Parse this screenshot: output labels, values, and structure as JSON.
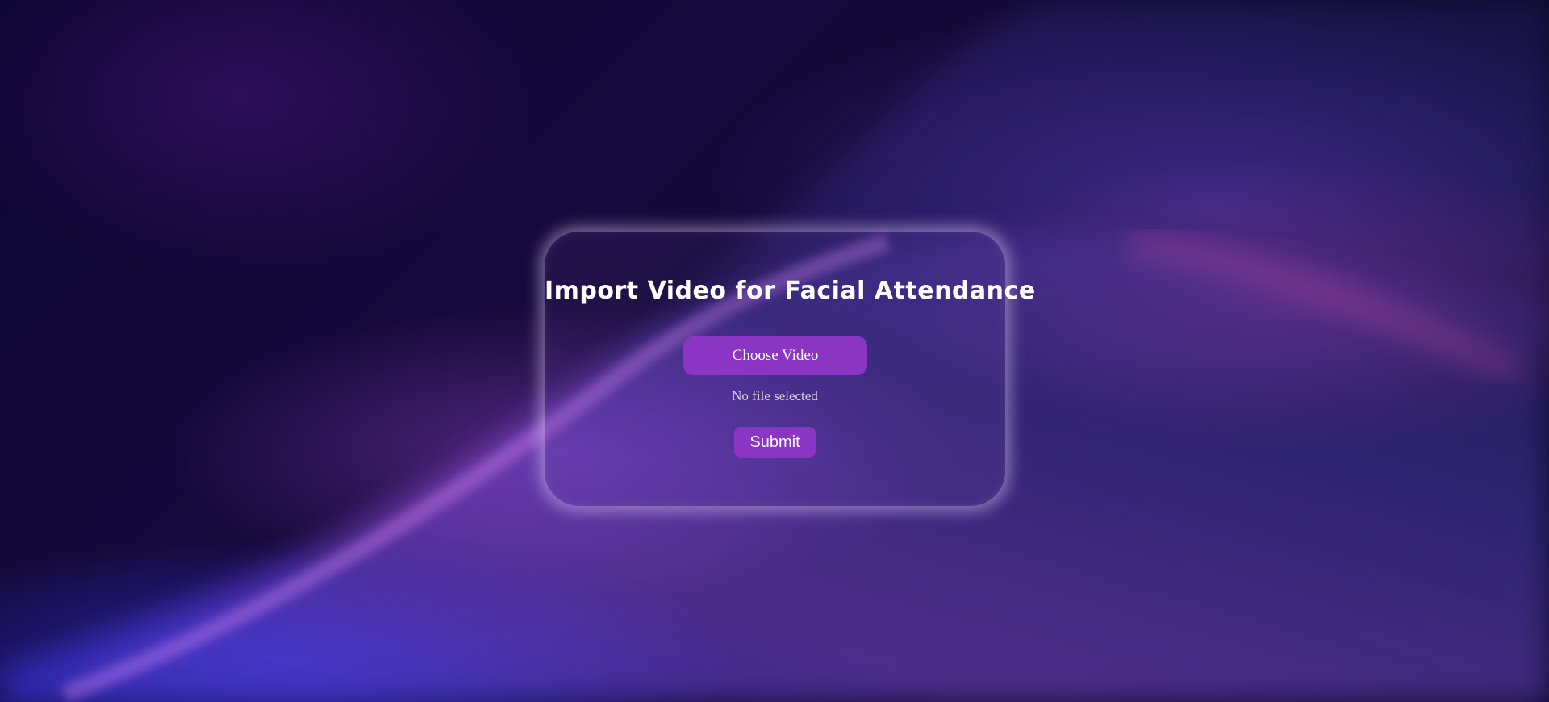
{
  "page": {
    "title": "Import Video for Facial Attendance"
  },
  "upload": {
    "choose_label": "Choose Video",
    "file_status": "No file selected",
    "submit_label": "Submit"
  },
  "colors": {
    "accent": "#8a35c4",
    "background": "#07051c",
    "text": "#ffffff"
  }
}
